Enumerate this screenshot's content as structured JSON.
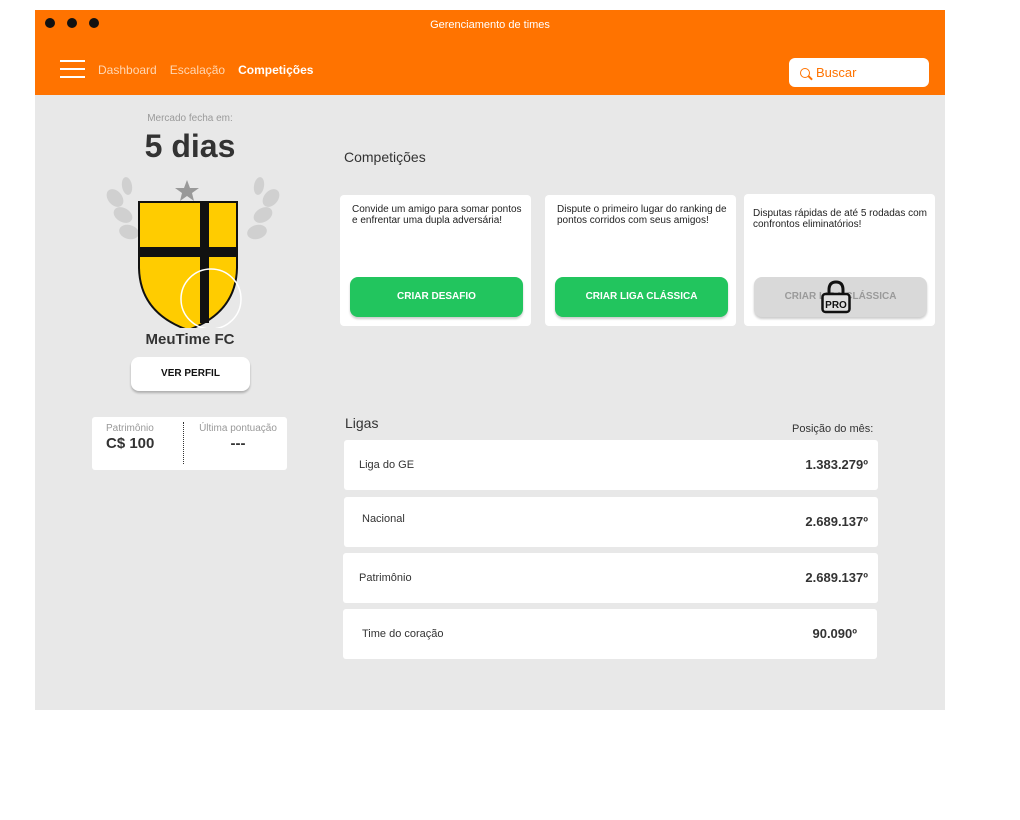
{
  "window": {
    "title": "Gerenciamento de times"
  },
  "nav": {
    "items": [
      "Dashboard",
      "Escalação",
      "Competições"
    ],
    "active_index": 2
  },
  "search": {
    "placeholder": "Buscar"
  },
  "market": {
    "label": "Mercado fecha em:",
    "value": "5 dias"
  },
  "team": {
    "name": "MeuTime FC",
    "profile_button": "VER PERFIL"
  },
  "stats": {
    "patrimonio_label": "Patrimônio",
    "patrimonio_value": "C$ 100",
    "last_score_label": "Última pontuação",
    "last_score_value": "---"
  },
  "competitions": {
    "title": "Competições",
    "cards": [
      {
        "desc": "Convide um amigo para somar pontos e enfrentar uma dupla adversária!",
        "button": "CRIAR DESAFIO",
        "locked": false
      },
      {
        "desc": "Dispute o primeiro lugar do ranking de pontos corridos com seus amigos!",
        "button": "CRIAR LIGA CLÁSSICA",
        "locked": false
      },
      {
        "desc": "Disputas rápidas de até 5 rodadas com confrontos eliminatórios!",
        "button": "CRIAR LIGA CLÁSSICA",
        "locked": true,
        "lock_badge": "PRO"
      }
    ]
  },
  "leagues": {
    "title": "Ligas",
    "month_label": "Posição do mês:",
    "rows": [
      {
        "name": "Liga do GE",
        "position": "1.383.279º"
      },
      {
        "name": "Nacional",
        "position": "2.689.137º"
      },
      {
        "name": "Patrimônio",
        "position": "2.689.137º"
      },
      {
        "name": "Time do coração",
        "position": "90.090º"
      }
    ]
  },
  "colors": {
    "brand": "#ff7300",
    "success": "#22c55e",
    "background": "#e8e8e8",
    "crest_yellow": "#ffcc00"
  }
}
